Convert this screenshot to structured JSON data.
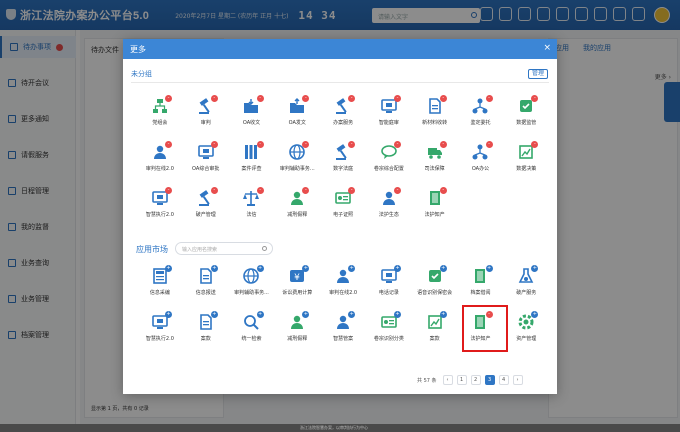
{
  "topbar": {
    "title": "浙江法院办案办公平台5.0",
    "datetime": "2020年2月7日 星期二 (农历年 正月 十七)",
    "clock": "14 34",
    "search_placeholder": "请输入文字"
  },
  "sidebar": {
    "items": [
      {
        "label": "待办事项",
        "active": true
      },
      {
        "label": "待开会议"
      },
      {
        "label": "更多通知"
      },
      {
        "label": "请假服务"
      },
      {
        "label": "日程管理"
      },
      {
        "label": "我的监督"
      },
      {
        "label": "业务查询"
      },
      {
        "label": "业务管理"
      },
      {
        "label": "档案管理"
      }
    ]
  },
  "background": {
    "left_panel_title": "待办文件",
    "right_tabs": [
      "应用",
      "我的应用"
    ],
    "right_more": "更多 ›",
    "status": "显示第 1 页，共有 0 记录"
  },
  "modal": {
    "title": "更多",
    "close": "×",
    "section_unassigned": "未分组",
    "manage_label": "管理",
    "market_title": "应用市场",
    "market_search_placeholder": "输入应用名搜索",
    "unassigned_apps": [
      {
        "label": "党组会",
        "icon": "org-chart-icon",
        "color": "#35a86b",
        "mark": "-"
      },
      {
        "label": "审判",
        "icon": "gavel-icon",
        "color": "#2f76c4",
        "mark": "-"
      },
      {
        "label": "OA收文",
        "icon": "folder-in-icon",
        "color": "#2f76c4",
        "mark": "-"
      },
      {
        "label": "OA发文",
        "icon": "folder-out-icon",
        "color": "#2f76c4",
        "mark": "-"
      },
      {
        "label": "办案服务",
        "icon": "gavel-icon",
        "color": "#2f76c4",
        "mark": "-"
      },
      {
        "label": "智能庭审",
        "icon": "monitor-icon",
        "color": "#2f76c4",
        "mark": "-"
      },
      {
        "label": "新材料收转",
        "icon": "document-icon",
        "color": "#2f76c4",
        "mark": "-"
      },
      {
        "label": "鉴定委托",
        "icon": "network-icon",
        "color": "#2f76c4",
        "mark": "-"
      },
      {
        "label": "数据监管",
        "icon": "checklist-icon",
        "color": "#35a86b",
        "mark": "-"
      },
      {
        "label": "审判在线2.0",
        "icon": "person-icon",
        "color": "#2f76c4",
        "mark": "-"
      },
      {
        "label": "OA综合审批",
        "icon": "monitor-icon",
        "color": "#2f76c4",
        "mark": "-"
      },
      {
        "label": "案件评查",
        "icon": "books-icon",
        "color": "#2f76c4",
        "mark": "-"
      },
      {
        "label": "审判辅助事务...",
        "icon": "globe-icon",
        "color": "#2f76c4",
        "mark": "-"
      },
      {
        "label": "数字法庭",
        "icon": "gavel-icon",
        "color": "#2f76c4",
        "mark": "-"
      },
      {
        "label": "卷宗综合配置",
        "icon": "chat-icon",
        "color": "#35a86b",
        "mark": "-"
      },
      {
        "label": "司法保障",
        "icon": "truck-icon",
        "color": "#35a86b",
        "mark": "-"
      },
      {
        "label": "OA办公",
        "icon": "network-icon",
        "color": "#2f76c4",
        "mark": "-"
      },
      {
        "label": "数据决策",
        "icon": "report-icon",
        "color": "#35a86b",
        "mark": "-"
      },
      {
        "label": "智慧执行2.0",
        "icon": "monitor-icon",
        "color": "#2f76c4",
        "mark": "-"
      },
      {
        "label": "破产管理",
        "icon": "gavel-icon",
        "color": "#2f76c4",
        "mark": "-"
      },
      {
        "label": "法信",
        "icon": "scales-icon",
        "color": "#2f76c4",
        "mark": "-"
      },
      {
        "label": "减刑假释",
        "icon": "person-icon",
        "color": "#35a86b",
        "mark": "-"
      },
      {
        "label": "电子证照",
        "icon": "id-card-icon",
        "color": "#35a86b",
        "mark": "-"
      },
      {
        "label": "法护生态",
        "icon": "person-icon",
        "color": "#2f76c4",
        "mark": "-"
      },
      {
        "label": "法护知产",
        "icon": "book-icon",
        "color": "#35a86b",
        "mark": "-"
      }
    ],
    "market_apps": [
      {
        "label": "信息采编",
        "icon": "news-icon",
        "color": "#2f76c4",
        "mark": "+"
      },
      {
        "label": "信息报送",
        "icon": "document-icon",
        "color": "#2f76c4",
        "mark": "+"
      },
      {
        "label": "审判辅助事务...",
        "icon": "globe-icon",
        "color": "#2f76c4",
        "mark": "+"
      },
      {
        "label": "诉讼费用计算",
        "icon": "money-icon",
        "color": "#2f76c4",
        "mark": "+"
      },
      {
        "label": "审判在线2.0",
        "icon": "person-icon",
        "color": "#2f76c4",
        "mark": "+"
      },
      {
        "label": "电话记录",
        "icon": "monitor-icon",
        "color": "#2f76c4",
        "mark": "+"
      },
      {
        "label": "语音识别保密会",
        "icon": "checklist-icon",
        "color": "#35a86b",
        "mark": "+"
      },
      {
        "label": "档案借阅",
        "icon": "book-icon",
        "color": "#35a86b",
        "mark": "+"
      },
      {
        "label": "破产服务",
        "icon": "flask-icon",
        "color": "#2f76c4",
        "mark": "+"
      },
      {
        "label": "智慧执行2.0",
        "icon": "monitor-icon",
        "color": "#2f76c4",
        "mark": "+"
      },
      {
        "label": "案款",
        "icon": "document-icon",
        "color": "#2f76c4",
        "mark": "+"
      },
      {
        "label": "统一检索",
        "icon": "search-icon",
        "color": "#2f76c4",
        "mark": "+"
      },
      {
        "label": "减刑假释",
        "icon": "person-icon",
        "color": "#35a86b",
        "mark": "+"
      },
      {
        "label": "智慧管案",
        "icon": "person-icon",
        "color": "#2f76c4",
        "mark": "+"
      },
      {
        "label": "卷宗识别分类",
        "icon": "id-card-icon",
        "color": "#35a86b",
        "mark": "+"
      },
      {
        "label": "案款",
        "icon": "report-icon",
        "color": "#35a86b",
        "mark": "+"
      },
      {
        "label": "法护知产",
        "icon": "book-icon",
        "color": "#35a86b",
        "mark": "-",
        "highlighted": true
      },
      {
        "label": "资产管理",
        "icon": "gear-icon",
        "color": "#35a86b",
        "mark": "+"
      }
    ],
    "pager": {
      "total": "共 57 条",
      "prev": "‹",
      "pages": [
        "1",
        "2",
        "3",
        "4"
      ],
      "current": "3",
      "next": "›"
    }
  },
  "footer_text": "浙江法院智慧办案，以审判执行为中心"
}
